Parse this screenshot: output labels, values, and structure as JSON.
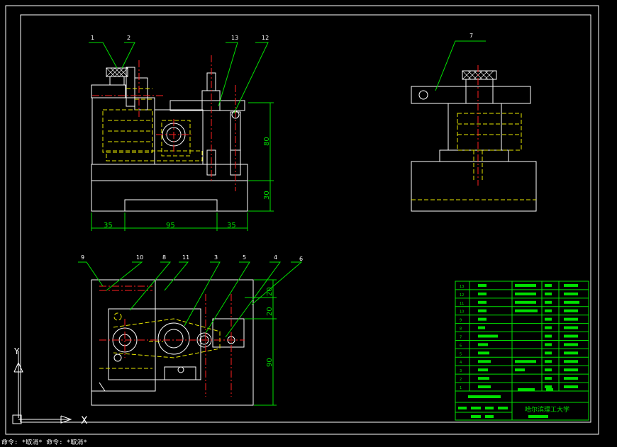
{
  "colors": {
    "background": "#000000",
    "outline": "#ffffff",
    "centerline": "#ff2020",
    "hidden": "#e8e800",
    "leader": "#00e000",
    "dimension": "#00e000",
    "table_line": "#00e000",
    "table_text": "#00e000"
  },
  "view_front": {
    "balloons": [
      "1",
      "2",
      "13",
      "12"
    ],
    "dims_horizontal": [
      "35",
      "95",
      "35"
    ],
    "dims_vertical": [
      "80",
      "30"
    ]
  },
  "view_side": {
    "balloons": [
      "7"
    ]
  },
  "view_top": {
    "balloons": [
      "9",
      "10",
      "8",
      "11",
      "3",
      "5",
      "4",
      "6"
    ],
    "dims_vertical": [
      "20",
      "20",
      "90"
    ]
  },
  "parts_list": {
    "row_numbers": [
      "13",
      "12",
      "11",
      "10",
      "9",
      "8",
      "7",
      "6",
      "5",
      "4",
      "3",
      "2",
      "1"
    ],
    "organization": "哈尔滨理工大学"
  },
  "ucs_icon": {
    "y_label": "Y",
    "x_label": "X"
  },
  "command_line": {
    "text": "命令: *取消*  命令: *取消*"
  }
}
